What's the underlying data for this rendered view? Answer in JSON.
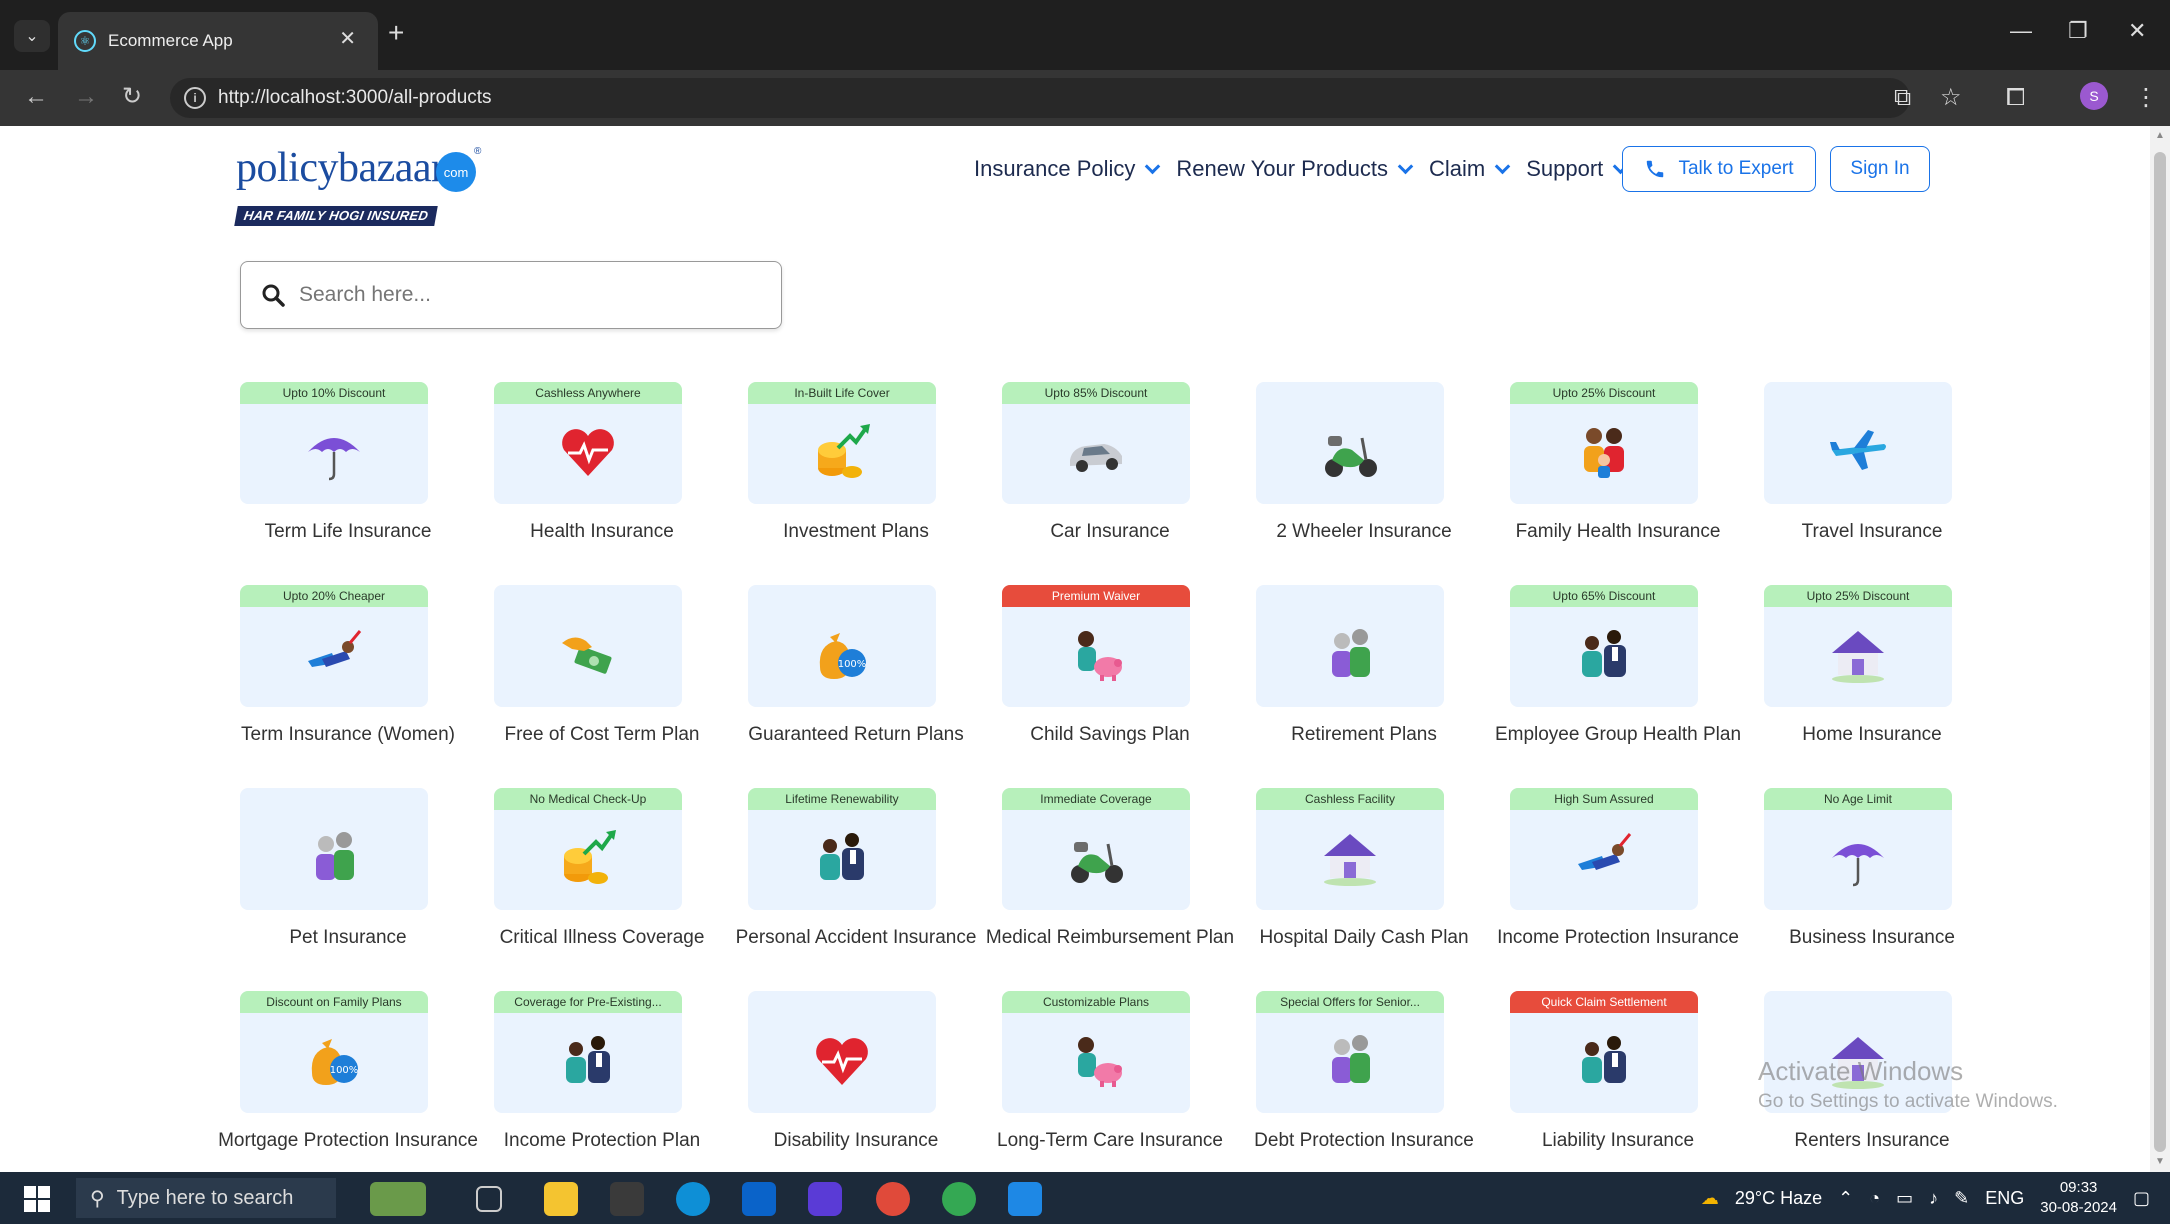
{
  "browser": {
    "tab_title": "Ecommerce App",
    "url": "http://localhost:3000/all-products",
    "profile_initial": "S"
  },
  "header": {
    "logo_word": "policybazaar",
    "logo_com": "com",
    "logo_tagline": "HAR FAMILY HOGI INSURED",
    "nav": [
      "Insurance Policy",
      "Renew Your Products",
      "Claim",
      "Support"
    ],
    "talk_to_expert": "Talk to Expert",
    "sign_in": "Sign In"
  },
  "search": {
    "placeholder": "Search here..."
  },
  "products": [
    {
      "label": "Term Life Insurance",
      "badge": "Upto 10% Discount",
      "badge_color": "#b7f0bb",
      "icon": "umbrella-icon"
    },
    {
      "label": "Health Insurance",
      "badge": "Cashless Anywhere",
      "badge_color": "#b7f0bb",
      "icon": "heart-icon"
    },
    {
      "label": "Investment Plans",
      "badge": "In-Built Life Cover",
      "badge_color": "#b7f0bb",
      "icon": "coins-growth-icon"
    },
    {
      "label": "Car Insurance",
      "badge": "Upto 85% Discount",
      "badge_color": "#b7f0bb",
      "icon": "car-icon"
    },
    {
      "label": "2 Wheeler Insurance",
      "badge": "",
      "badge_color": "",
      "icon": "scooter-icon"
    },
    {
      "label": "Family Health Insurance",
      "badge": "Upto 25% Discount",
      "badge_color": "#b7f0bb",
      "icon": "family-icon"
    },
    {
      "label": "Travel Insurance",
      "badge": "",
      "badge_color": "",
      "icon": "airplane-icon"
    },
    {
      "label": "Term Insurance (Women)",
      "badge": "Upto 20% Cheaper",
      "badge_color": "#b7f0bb",
      "icon": "superwoman-icon"
    },
    {
      "label": "Free of Cost Term Plan",
      "badge": "",
      "badge_color": "",
      "icon": "cash-hand-icon"
    },
    {
      "label": "Guaranteed Return Plans",
      "badge": "",
      "badge_color": "",
      "icon": "money-bag-icon"
    },
    {
      "label": "Child Savings Plan",
      "badge": "Premium Waiver",
      "badge_color": "#e74c3c",
      "icon": "child-piggybank-icon"
    },
    {
      "label": "Retirement Plans",
      "badge": "",
      "badge_color": "",
      "icon": "elderly-couple-icon"
    },
    {
      "label": "Employee Group Health Plan",
      "badge": "Upto 65% Discount",
      "badge_color": "#b7f0bb",
      "icon": "employees-icon"
    },
    {
      "label": "Home Insurance",
      "badge": "Upto 25% Discount",
      "badge_color": "#b7f0bb",
      "icon": "house-icon"
    },
    {
      "label": "Pet Insurance",
      "badge": "",
      "badge_color": "",
      "icon": "elderly-couple-icon"
    },
    {
      "label": "Critical Illness Coverage",
      "badge": "No Medical Check-Up",
      "badge_color": "#b7f0bb",
      "icon": "coins-growth-icon"
    },
    {
      "label": "Personal Accident Insurance",
      "badge": "Lifetime Renewability",
      "badge_color": "#b7f0bb",
      "icon": "employees-icon"
    },
    {
      "label": "Medical Reimbursement Plan",
      "badge": "Immediate Coverage",
      "badge_color": "#b7f0bb",
      "icon": "scooter-icon"
    },
    {
      "label": "Hospital Daily Cash Plan",
      "badge": "Cashless Facility",
      "badge_color": "#b7f0bb",
      "icon": "house-icon"
    },
    {
      "label": "Income Protection Insurance",
      "badge": "High Sum Assured",
      "badge_color": "#b7f0bb",
      "icon": "superwoman-icon"
    },
    {
      "label": "Business Insurance",
      "badge": "No Age Limit",
      "badge_color": "#b7f0bb",
      "icon": "umbrella-icon"
    },
    {
      "label": "Mortgage Protection Insurance",
      "badge": "Discount on Family Plans",
      "badge_color": "#b7f0bb",
      "icon": "money-bag-icon"
    },
    {
      "label": "Income Protection Plan",
      "badge": "Coverage for Pre-Existing...",
      "badge_color": "#b7f0bb",
      "icon": "employees-icon"
    },
    {
      "label": "Disability Insurance",
      "badge": "",
      "badge_color": "",
      "icon": "heart-icon"
    },
    {
      "label": "Long-Term Care Insurance",
      "badge": "Customizable Plans",
      "badge_color": "#b7f0bb",
      "icon": "child-piggybank-icon"
    },
    {
      "label": "Debt Protection Insurance",
      "badge": "Special Offers for Senior...",
      "badge_color": "#b7f0bb",
      "icon": "elderly-couple-icon"
    },
    {
      "label": "Liability Insurance",
      "badge": "Quick Claim Settlement",
      "badge_color": "#e74c3c",
      "icon": "employees-icon"
    },
    {
      "label": "Renters Insurance",
      "badge": "",
      "badge_color": "",
      "icon": "house-icon"
    }
  ],
  "watermark": {
    "line1": "Activate Windows",
    "line2": "Go to Settings to activate Windows."
  },
  "taskbar": {
    "search_placeholder": "Type here to search",
    "weather": "29°C  Haze",
    "language": "ENG",
    "time": "09:33",
    "date": "30-08-2024"
  }
}
